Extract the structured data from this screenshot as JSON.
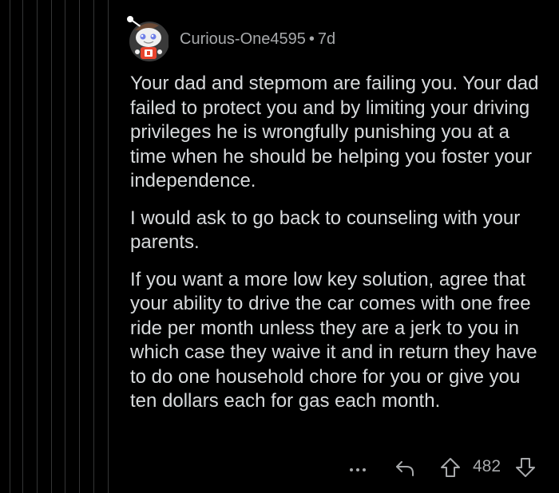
{
  "comment": {
    "author": "Curious-One4595",
    "separator": "•",
    "age": "7d",
    "paragraphs": [
      "Your dad and stepmom are failing you. Your dad failed to protect you and by limiting your driving privileges he is wrongfully punishing you at a time when he should be helping you foster your independence.",
      "I would ask to go back to counseling with your parents.",
      "If you want a more low key solution, agree that your ability to drive the car comes with one free ride per month unless they are a jerk to you in which case they waive it and in return they have to do one household chore for you or give you ten dollars each for gas each month."
    ],
    "score": "482"
  },
  "icons": {
    "more": "more-options-icon",
    "reply": "reply-icon",
    "upvote": "upvote-icon",
    "downvote": "downvote-icon"
  },
  "colors": {
    "background": "#000000",
    "text": "#d7dadc",
    "meta": "#a7a9ab",
    "thread_line": "#343536"
  }
}
